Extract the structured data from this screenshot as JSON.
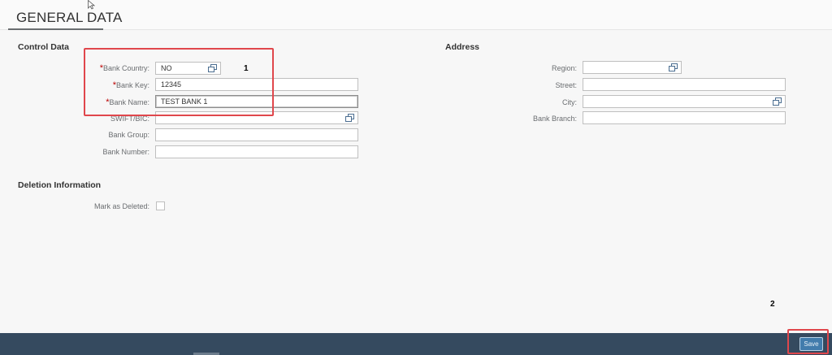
{
  "page": {
    "title": "GENERAL DATA"
  },
  "control_data": {
    "title": "Control Data",
    "fields": [
      {
        "label": "Bank Country:",
        "value": "NO",
        "required": true,
        "value_help": true
      },
      {
        "label": "Bank Key:",
        "value": "12345",
        "required": true,
        "value_help": false
      },
      {
        "label": "Bank Name:",
        "value": "TEST BANK 1",
        "required": true,
        "value_help": false
      },
      {
        "label": "SWIFT/BIC:",
        "value": "",
        "required": false,
        "value_help": true
      },
      {
        "label": "Bank Group:",
        "value": "",
        "required": false,
        "value_help": false
      },
      {
        "label": "Bank Number:",
        "value": "",
        "required": false,
        "value_help": false
      }
    ]
  },
  "address": {
    "title": "Address",
    "fields": [
      {
        "label": "Region:",
        "value": "",
        "value_help": true
      },
      {
        "label": "Street:",
        "value": "",
        "value_help": false
      },
      {
        "label": "City:",
        "value": "",
        "value_help": true
      },
      {
        "label": "Bank Branch:",
        "value": "",
        "value_help": false
      }
    ]
  },
  "deletion": {
    "title": "Deletion Information",
    "mark_label": "Mark as Deleted:",
    "checked": false
  },
  "annotations": {
    "marker1": "1",
    "marker2": "2",
    "color": "#e0474c"
  },
  "footer": {
    "save_label": "Save",
    "accent": "#427cac",
    "bar_color": "#354a5f"
  },
  "required_mark": "*"
}
